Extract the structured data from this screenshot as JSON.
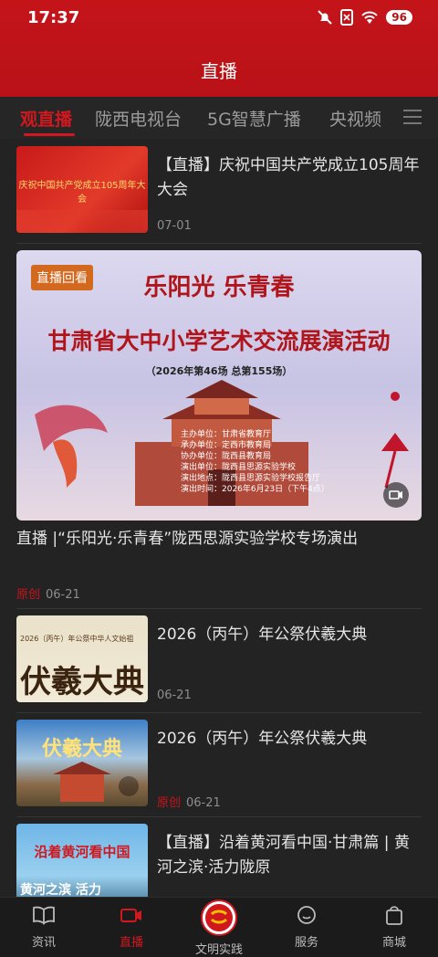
{
  "status": {
    "time": "17:37",
    "battery": "96"
  },
  "header": {
    "title": "直播"
  },
  "tabs": [
    {
      "label": "观直播"
    },
    {
      "label": "陇西电视台"
    },
    {
      "label": "5G智慧广播"
    },
    {
      "label": "央视频"
    }
  ],
  "items": [
    {
      "title": "【直播】庆祝中国共产党成立105周年大会",
      "date": "07-01",
      "thumb_text": "庆祝中国共产党成立105周年大会"
    },
    {
      "title": "2026（丙午）年公祭伏羲大典",
      "date": "06-21",
      "thumb_text": "伏羲大典",
      "thumb_sub": "2026（丙午）年公祭中华人文始祖"
    },
    {
      "title": "2026（丙午）年公祭伏羲大典",
      "date": "06-21",
      "origin": "原创",
      "thumb_text": "伏羲大典"
    },
    {
      "title": "【直播】沿着黄河看中国·甘肃篇 | 黄河之滨·活力陇原",
      "thumb_text": "沿着黄河看中国",
      "thumb_sub": "黄河之滨 活力"
    }
  ],
  "banner": {
    "badge": "直播回看",
    "line1": "乐阳光  乐青春",
    "line2": "甘肃省大中小学艺术交流展演活动",
    "line3": "（2026年第46场   总第155场）",
    "info": [
      "主办单位：甘肃省教育厅",
      "承办单位：定西市教育局",
      "协办单位：陇西县教育局",
      "演出单位：陇西县思源实验学校",
      "演出地点：陇西县思源实验学校报告厅",
      "演出时间：2026年6月23日（下午4点）"
    ],
    "title": "直播 |“乐阳光·乐青春”陇西思源实验学校专场演出",
    "origin": "原创",
    "date": "06-21"
  },
  "nav": [
    {
      "label": "资讯"
    },
    {
      "label": "直播"
    },
    {
      "label": "文明实践"
    },
    {
      "label": "服务"
    },
    {
      "label": "商城"
    }
  ]
}
